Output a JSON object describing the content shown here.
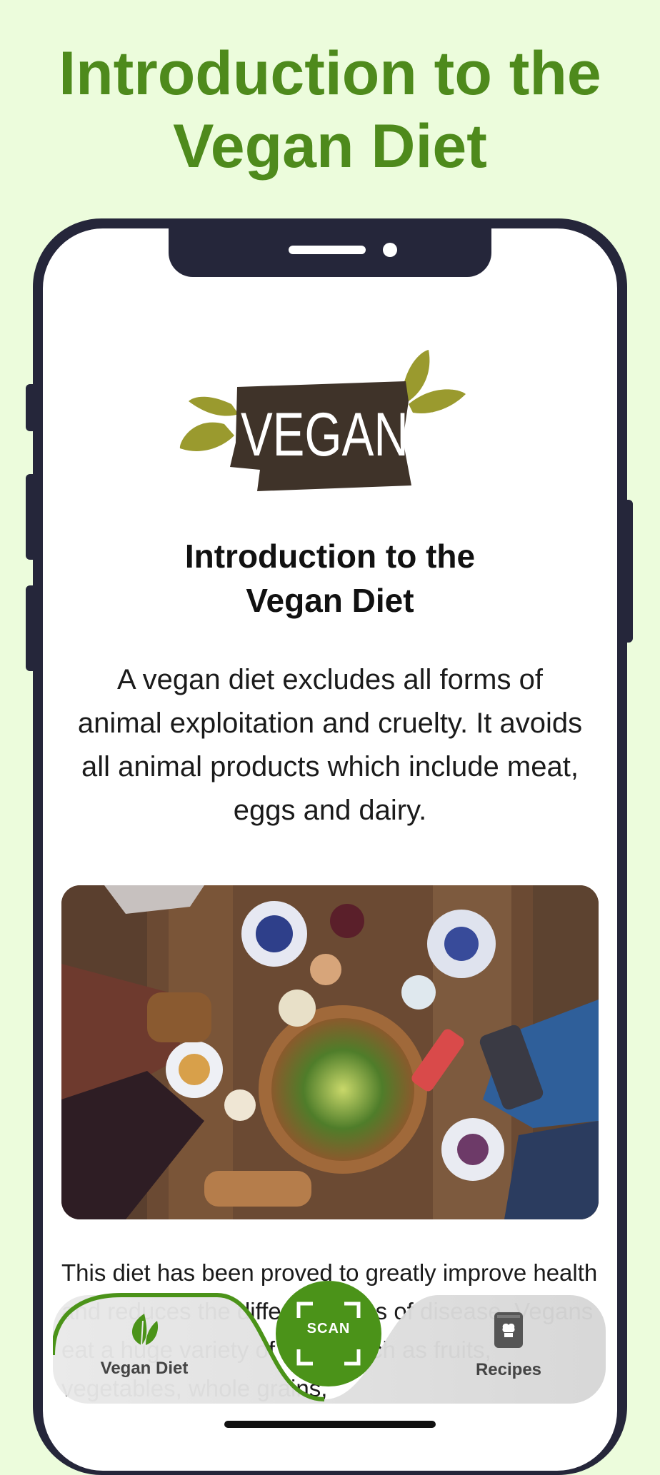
{
  "promo": {
    "title_line1": "Introduction to the",
    "title_line2": "Vegan Diet"
  },
  "screen": {
    "logo_text": "VEGAN",
    "title_line1": "Introduction to the",
    "title_line2": "Vegan Diet",
    "intro": "A vegan diet excludes all forms of animal exploitation and cruelty. It avoids all animal products which include meat, eggs and dairy.",
    "body": "This diet has been proved to greatly improve health and reduces the different forms of disease. Vegans eat a huge variety of foods such as fruits, vegetables, whole grains,"
  },
  "nav": {
    "items": [
      {
        "label": "Vegan Diet",
        "icon": "leaf-icon",
        "active": true
      },
      {
        "label": "SCAN",
        "icon": "scan-frame-icon"
      },
      {
        "label": "Recipes",
        "icon": "recipe-book-icon"
      }
    ]
  },
  "colors": {
    "background": "#ecfcdc",
    "brand_green": "#4e8a1c",
    "scan_green": "#4b9319",
    "logo_brown": "#3f3329",
    "logo_leaf": "#9a9a2e",
    "phone_frame": "#25263a"
  }
}
